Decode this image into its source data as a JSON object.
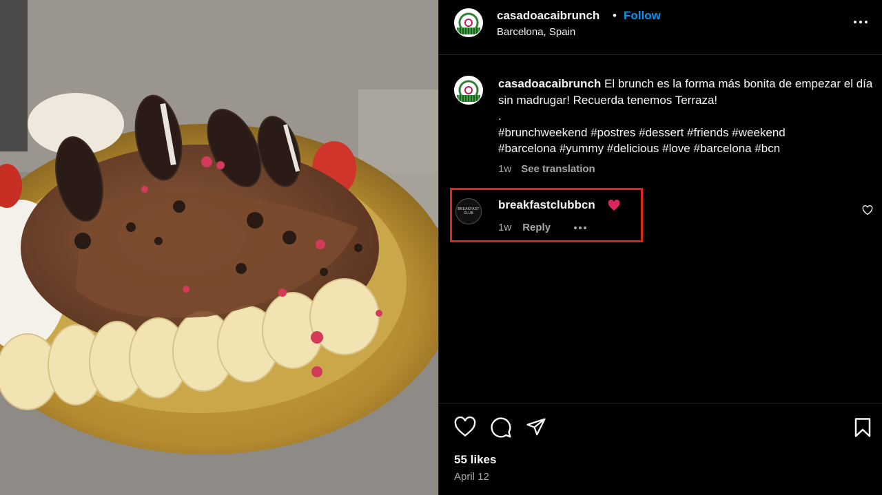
{
  "post": {
    "username": "casadoacaibrunch",
    "separator": "•",
    "follow_label": "Follow",
    "location": "Barcelona, Spain",
    "more_icon": "more-horizontal-icon",
    "photo_description_icon": "dessert-photo"
  },
  "caption": {
    "username": "casadoacaibrunch",
    "text_line1": "El brunch es la forma más bonita de empezar el día sin madrugar! Recuerda tenemos Terraza!",
    "text_dot": ".",
    "hashtags": "#brunchweekend #postres #dessert #friends #weekend #barcelona #yummy #delicious #love #barcelona #bcn",
    "age": "1w",
    "see_translation": "See translation"
  },
  "comment": {
    "username": "breakfastclubbcn",
    "emoji": "heart-emoji",
    "avatar_text": "BREAKFAST CLUB",
    "age": "1w",
    "reply_label": "Reply"
  },
  "footer": {
    "likes": "55 likes",
    "date": "April 12",
    "icons": [
      "heart-icon",
      "comment-icon",
      "share-icon",
      "bookmark-icon"
    ]
  },
  "colors": {
    "background": "#000000",
    "text": "#f5f5f5",
    "muted": "#a8a8a8",
    "follow_blue": "#0095f6",
    "highlight_red": "#e2231a"
  }
}
